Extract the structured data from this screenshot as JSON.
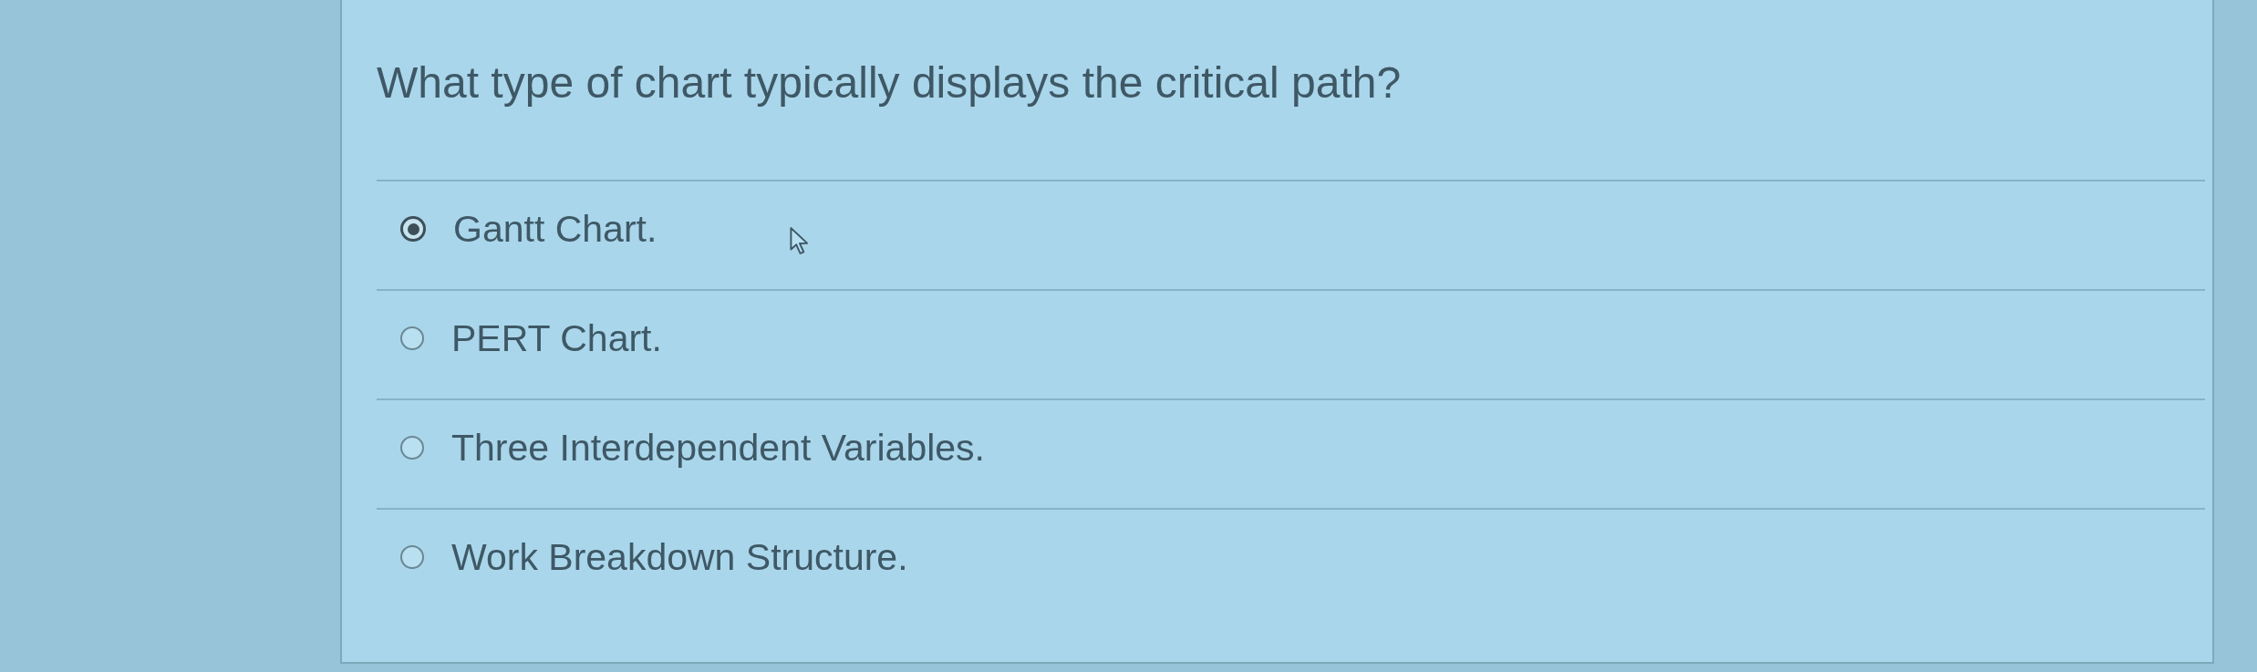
{
  "question": {
    "text": "What type of chart typically displays the critical path?"
  },
  "options": [
    {
      "label": "Gantt Chart.",
      "selected": true
    },
    {
      "label": "PERT Chart.",
      "selected": false
    },
    {
      "label": "Three Interdependent Variables.",
      "selected": false
    },
    {
      "label": "Work Breakdown Structure.",
      "selected": false
    }
  ]
}
